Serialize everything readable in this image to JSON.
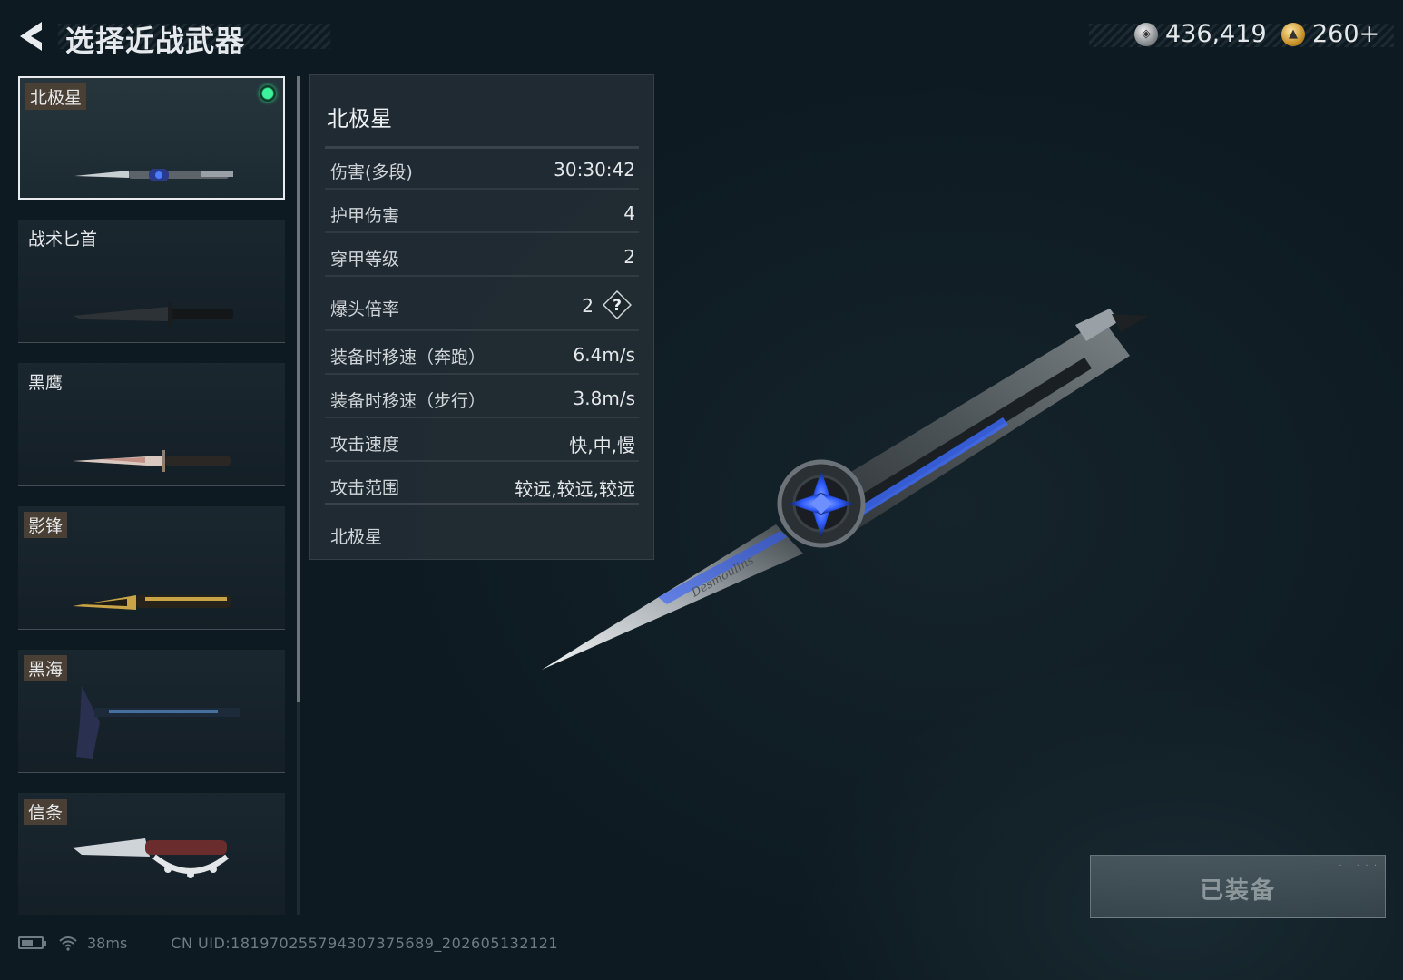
{
  "header": {
    "title": "选择近战武器",
    "currency_silver": "436,419",
    "currency_gold": "260+"
  },
  "weapon_list": [
    {
      "name": "北极星",
      "selected": true,
      "equipped": true,
      "tagged": true
    },
    {
      "name": "战术匕首",
      "selected": false,
      "equipped": false,
      "tagged": false
    },
    {
      "name": "黑鹰",
      "selected": false,
      "equipped": false,
      "tagged": false
    },
    {
      "name": "影锋",
      "selected": false,
      "equipped": false,
      "tagged": true
    },
    {
      "name": "黑海",
      "selected": false,
      "equipped": false,
      "tagged": true
    },
    {
      "name": "信条",
      "selected": false,
      "equipped": false,
      "tagged": true
    }
  ],
  "stats": {
    "title": "北极星",
    "rows": [
      {
        "label": "伤害(多段)",
        "value": "30:30:42"
      },
      {
        "label": "护甲伤害",
        "value": "4"
      },
      {
        "label": "穿甲等级",
        "value": "2"
      },
      {
        "label": "爆头倍率",
        "value": "2"
      },
      {
        "label": "装备时移速（奔跑）",
        "value": "6.4m/s"
      },
      {
        "label": "装备时移速（步行）",
        "value": "3.8m/s"
      },
      {
        "label": "攻击速度",
        "value": "快,中,慢"
      },
      {
        "label": "攻击范围",
        "value": "较远,较远,较远"
      }
    ],
    "footer": "北极星",
    "help_symbol": "?"
  },
  "hero": {
    "engraving": "Desmoulins"
  },
  "equip_button": {
    "label": "已装备"
  },
  "status_bar": {
    "ping": "38ms",
    "uid": "CN UID:181970255794307375689_202605132121",
    "battery_level": 0.6
  },
  "colors": {
    "equipped_indicator": "#3cf29a",
    "accent_blue": "#2f5cff"
  }
}
